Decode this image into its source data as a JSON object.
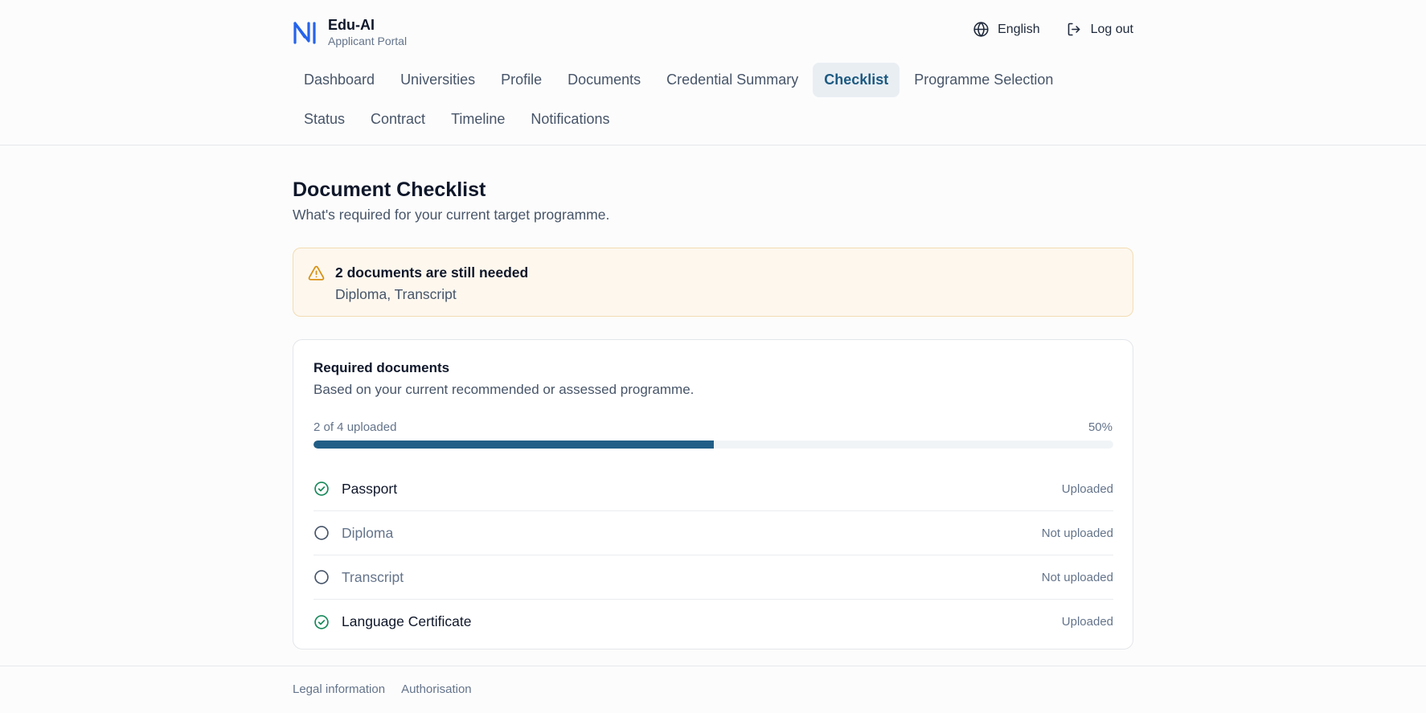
{
  "brand": {
    "name": "Edu-AI",
    "subtitle": "Applicant Portal",
    "logo_icon": "n-logo-icon",
    "accent": "#2563eb"
  },
  "header": {
    "language": {
      "label": "English",
      "icon": "globe-icon"
    },
    "logout": {
      "label": "Log out",
      "icon": "logout-icon"
    }
  },
  "nav": {
    "row1": [
      "Dashboard",
      "Universities",
      "Profile",
      "Documents",
      "Credential Summary",
      "Checklist",
      "Programme Selection"
    ],
    "row2": [
      "Status",
      "Contract",
      "Timeline",
      "Notifications"
    ],
    "active": "Checklist"
  },
  "page": {
    "title": "Document Checklist",
    "subtitle": "What's required for your current target programme."
  },
  "alert": {
    "icon": "warning-icon",
    "title": "2 documents are still needed",
    "items": "Diploma, Transcript",
    "color": "#f3dcb3"
  },
  "card": {
    "title": "Required documents",
    "subtitle": "Based on your current recommended or assessed programme.",
    "progress_label": "2 of 4 uploaded",
    "progress_percent_label": "50%",
    "progress_value": 0.5,
    "progress_color": "#215e87",
    "documents": [
      {
        "name": "Passport",
        "status": "Uploaded",
        "uploaded": true
      },
      {
        "name": "Diploma",
        "status": "Not uploaded",
        "uploaded": false
      },
      {
        "name": "Transcript",
        "status": "Not uploaded",
        "uploaded": false
      },
      {
        "name": "Language Certificate",
        "status": "Uploaded",
        "uploaded": true
      }
    ]
  },
  "footer": {
    "links": [
      "Legal information",
      "Authorisation"
    ]
  },
  "colors": {
    "success": "#16885a",
    "neutral_icon": "#475569"
  }
}
